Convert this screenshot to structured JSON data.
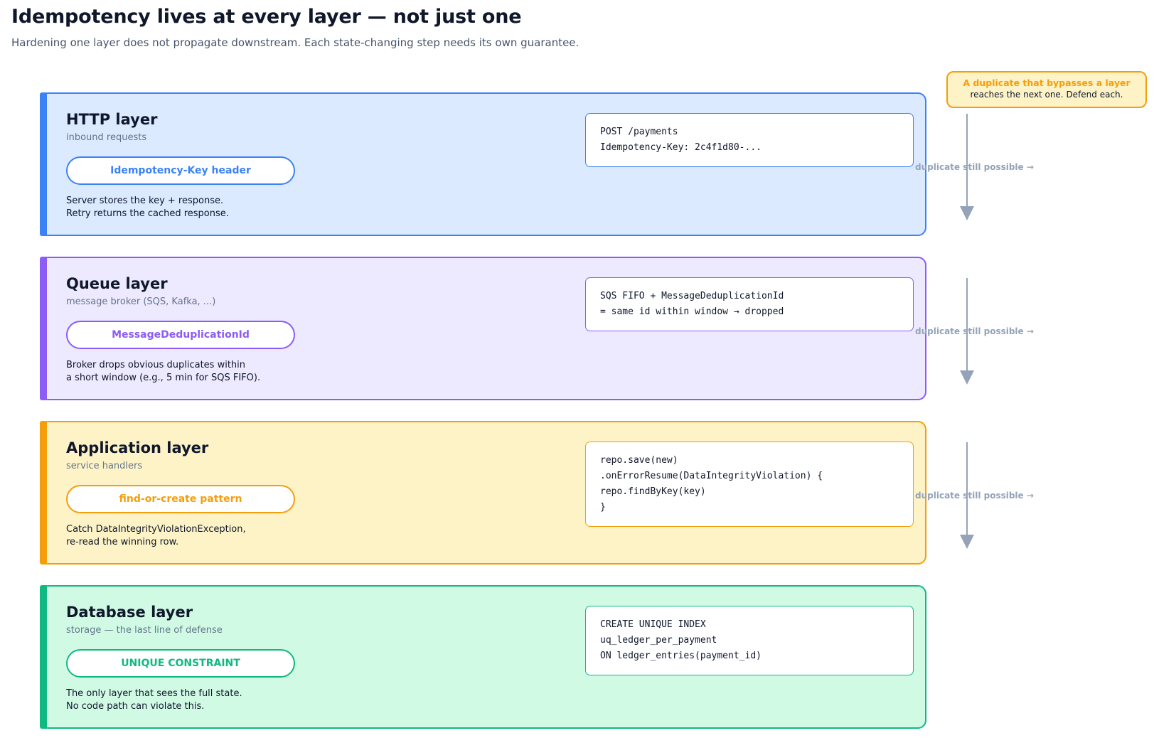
{
  "header": {
    "title": "Idempotency lives at every layer — not just one",
    "subtitle": "Hardening one layer does not propagate downstream. Each state-changing step needs its own guarantee."
  },
  "callout": {
    "title": "A duplicate that bypasses a layer",
    "text": "reaches the next one. Defend each."
  },
  "arrow_label": "duplicate still possible →",
  "layers": [
    {
      "name": "HTTP layer",
      "subtitle": "inbound requests",
      "mechanism": "Idempotency-Key header",
      "description": [
        "Server stores the key + response.",
        "Retry returns the cached response."
      ],
      "code": [
        "POST /payments",
        "Idempotency-Key: 2c4f1d80-..."
      ],
      "color": "#3b82f6"
    },
    {
      "name": "Queue layer",
      "subtitle": "message broker (SQS, Kafka, ...)",
      "mechanism": "MessageDeduplicationId",
      "description": [
        "Broker drops obvious duplicates within",
        "a short window (e.g., 5 min for SQS FIFO)."
      ],
      "code": [
        "SQS FIFO + MessageDeduplicationId",
        "= same id within window → dropped"
      ],
      "color": "#8b5cf6"
    },
    {
      "name": "Application layer",
      "subtitle": "service handlers",
      "mechanism": "find-or-create pattern",
      "description": [
        "Catch DataIntegrityViolationException,",
        "re-read the winning row."
      ],
      "code": [
        "repo.save(new)",
        ".onErrorResume(DataIntegrityViolation) {",
        "repo.findByKey(key)",
        "}"
      ],
      "color": "#f59e0b"
    },
    {
      "name": "Database layer",
      "subtitle": "storage — the last line of defense",
      "mechanism": "UNIQUE CONSTRAINT",
      "description": [
        "The only layer that sees the full state.",
        "No code path can violate this."
      ],
      "code": [
        "CREATE UNIQUE INDEX",
        "uq_ledger_per_payment",
        "ON ledger_entries(payment_id)"
      ],
      "color": "#10b981"
    }
  ]
}
